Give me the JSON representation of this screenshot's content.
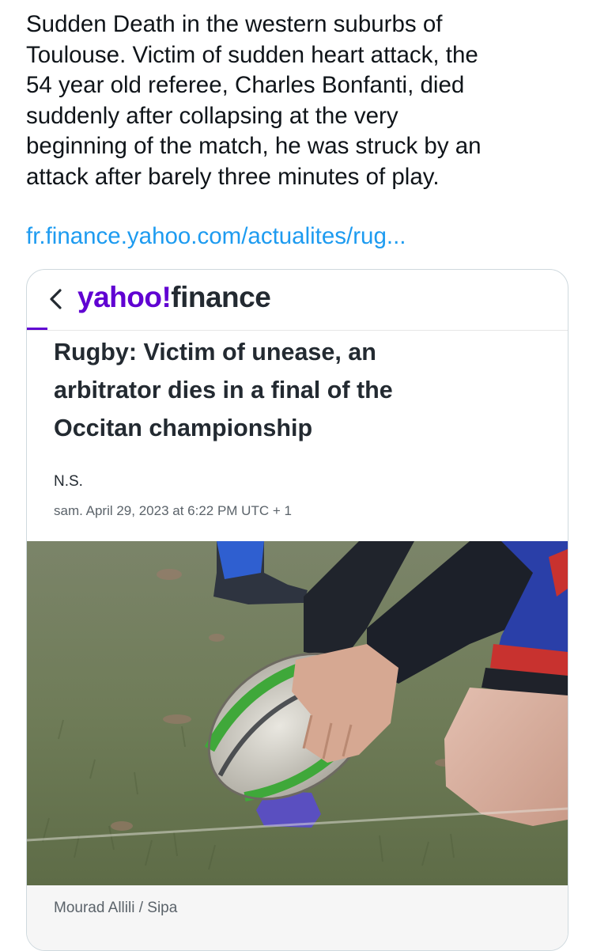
{
  "tweet": {
    "text": "Sudden Death in the western suburbs of\nToulouse. Victim of sudden heart attack, the\n54 year old referee, Charles Bonfanti, died\nsuddenly after collapsing at the very\nbeginning of the match, he was struck by an\nattack after barely three minutes of play.",
    "link": "fr.finance.yahoo.com/actualites/rug..."
  },
  "card": {
    "logo_primary": "yahoo!",
    "logo_secondary": "finance",
    "title": "Rugby: Victim of unease, an\narbitrator dies in a final of the\nOccitan championship",
    "author": "N.S.",
    "date": "sam. April 29, 2023 at 6:22 PM UTC + 1",
    "photo_caption": "Mourad Allili / Sipa"
  },
  "colors": {
    "link": "#1d9bf0",
    "yahoo_purple": "#6001d2",
    "text": "#0f1419"
  },
  "icons": {
    "back": "chevron-left-icon"
  }
}
